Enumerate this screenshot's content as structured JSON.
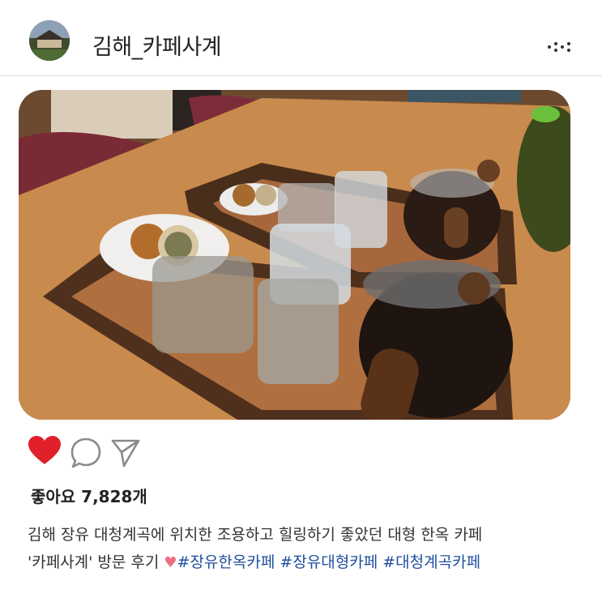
{
  "post": {
    "author": "김해_카페사계",
    "likes_text": "좋아요 7,828개",
    "caption_line1": "김해 장유 대청계곡에 위치한 조용하고 힐링하기 좋았던 대형 한옥 카페",
    "caption_line2_text": "'카페사계' 방문 후기 ",
    "caption_emoji": "♥",
    "hashtags": [
      "#장유한옥카페",
      "#장유대형카페",
      "#대청계곡카페"
    ],
    "liked": true
  },
  "icons": {
    "more": "more-dots-icon",
    "like": "heart-icon",
    "comment": "comment-bubble-icon",
    "share": "paper-plane-icon"
  },
  "colors": {
    "like_red": "#e0202b",
    "hashtag_blue": "#1f4e9e",
    "emoji_pink": "#ec6e7f"
  }
}
